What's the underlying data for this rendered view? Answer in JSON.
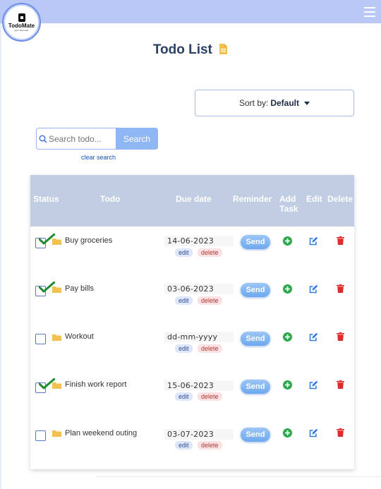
{
  "app": {
    "logo_text": "TodoMate",
    "logo_subtext": "get it done fast"
  },
  "page": {
    "title": "Todo List"
  },
  "sort": {
    "label": "Sort by:",
    "value": "Default"
  },
  "search": {
    "placeholder": "Search todo...",
    "button_label": "Search",
    "clear_label": "clear search"
  },
  "table": {
    "headers": {
      "status": "Status",
      "todo": "Todo",
      "due_date": "Due date",
      "reminder": "Reminder",
      "add_task_1": "Add",
      "add_task_2": "Task",
      "edit": "Edit",
      "delete": "Delete"
    },
    "rows": [
      {
        "todo": "Buy groceries",
        "due_date": "14-06-2023",
        "completed": true,
        "date_edit": "edit",
        "date_delete": "delete",
        "send": "Send"
      },
      {
        "todo": "Pay bills",
        "due_date": "03-06-2023",
        "completed": true,
        "date_edit": "edit",
        "date_delete": "delete",
        "send": "Send"
      },
      {
        "todo": "Workout",
        "due_date": "dd-mm-yyyy",
        "completed": false,
        "date_edit": "edit",
        "date_delete": "delete",
        "send": "Send"
      },
      {
        "todo": "Finish work report",
        "due_date": "15-06-2023",
        "completed": true,
        "date_edit": "edit",
        "date_delete": "delete",
        "send": "Send"
      },
      {
        "todo": "Plan weekend outing",
        "due_date": "03-07-2023",
        "completed": false,
        "date_edit": "edit",
        "date_delete": "delete",
        "send": "Send"
      }
    ]
  },
  "colors": {
    "topbar": "#b9c8f7",
    "table_header": "#c0cde2",
    "check": "#1e8c2e",
    "add_icon": "#2aa84a",
    "edit_icon": "#2f7be4",
    "trash_icon": "#e12b2b",
    "folder": "#f2c14e"
  },
  "icons": [
    "menu-icon",
    "document-icon",
    "search-icon",
    "caret-down-icon",
    "folder-icon",
    "check-icon",
    "add-circle-icon",
    "edit-icon",
    "trash-icon"
  ]
}
